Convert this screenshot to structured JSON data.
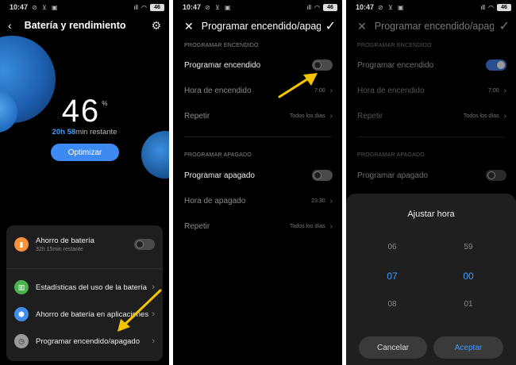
{
  "status": {
    "time": "10:47",
    "icons": "⊘ ⊻ ▣",
    "signal": "ıll",
    "wifi": "◠",
    "battery": "46"
  },
  "phone1": {
    "title": "Batería y rendimiento",
    "percent": "46",
    "percent_sym": "%",
    "remaining_h": "20h",
    "remaining_m": "58",
    "remaining_suffix": "min restante",
    "optimize_label": "Optimizar",
    "saver": {
      "title": "Ahorro de batería",
      "sub": "32h 15min restante",
      "on": false
    },
    "items": [
      {
        "label": "Estadísticas del uso de la batería",
        "icon": "bar-chart-icon",
        "color": "#47b24e"
      },
      {
        "label": "Ahorro de batería en aplicaciones",
        "icon": "app-battery-icon",
        "color": "#3f8eea"
      },
      {
        "label": "Programar encendido/apagado",
        "icon": "clock-icon",
        "color": "#9a9a9a"
      }
    ]
  },
  "phone2": {
    "title": "Programar encendido/apagado",
    "on_section": "PROGRAMAR ENCENDIDO",
    "on_toggle_label": "Programar encendido",
    "on_time_label": "Hora de encendido",
    "on_time_value": "7:00",
    "on_repeat_label": "Repetir",
    "on_repeat_value": "Todos los días",
    "off_section": "PROGRAMAR APAGADO",
    "off_toggle_label": "Programar apagado",
    "off_time_label": "Hora de apagado",
    "off_time_value": "23:30",
    "off_repeat_label": "Repetir",
    "off_repeat_value": "Todos los días"
  },
  "phone3": {
    "title": "Programar encendido/apagado",
    "on_section": "PROGRAMAR ENCENDIDO",
    "on_toggle_label": "Programar encendido",
    "on_time_label": "Hora de encendido",
    "on_time_value": "7:00",
    "on_repeat_label": "Repetir",
    "on_repeat_value": "Todos los días",
    "off_section": "PROGRAMAR APAGADO",
    "off_toggle_label": "Programar apagado",
    "sheet_title": "Ajustar hora",
    "hours": [
      "06",
      "07",
      "08"
    ],
    "minutes": [
      "59",
      "00",
      "01"
    ],
    "cancel_label": "Cancelar",
    "accept_label": "Aceptar"
  },
  "colors": {
    "accent": "#3f9cff",
    "annotation_arrow": "#f5c400"
  }
}
